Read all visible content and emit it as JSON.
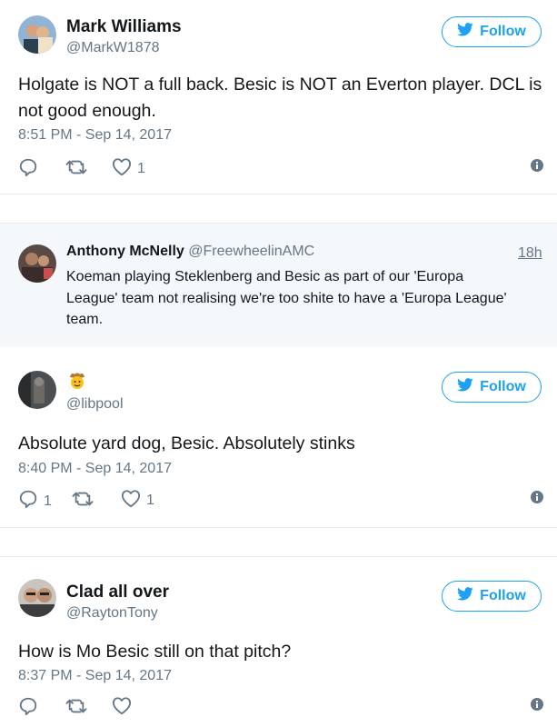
{
  "tweets": [
    {
      "name": "Mark Williams",
      "handle": "@MarkW1878",
      "follow_label": "Follow",
      "text_lines": [
        "Holgate is NOT a full back. Besic is NOT an Everton player. DCL is",
        "not good enough."
      ],
      "time": "8:51 PM - Sep 14, 2017",
      "reply_count": "",
      "like_count": "1"
    },
    {
      "name": "",
      "handle": "@libpool",
      "follow_label": "Follow",
      "text_lines": [
        "Absolute yard dog, Besic. Absolutely stinks"
      ],
      "time": "8:40 PM - Sep 14, 2017",
      "reply_count": "1",
      "like_count": "1"
    },
    {
      "name": "Clad all over",
      "handle": "@RaytonTony",
      "follow_label": "Follow",
      "text_lines": [
        "How is Mo Besic still on that pitch?"
      ],
      "time": "8:37 PM - Sep 14, 2017",
      "reply_count": "",
      "like_count": ""
    }
  ],
  "quoted": {
    "name": "Anthony McNelly",
    "handle": "@FreewheelinAMC",
    "age": "18h",
    "text_lines": [
      "Koeman playing Steklenberg and Besic as part of our 'Europa",
      "League' team not realising we're too shite to have a 'Europa League'",
      "team."
    ]
  },
  "colors": {
    "accent": "#1da1f2",
    "muted": "#657786",
    "text": "#14171a",
    "reply_bg": "#f5f8fa"
  },
  "icons": [
    "twitter-bird-icon",
    "reply-icon",
    "retweet-icon",
    "like-icon",
    "info-icon",
    "cowboy-emoji-icon"
  ]
}
